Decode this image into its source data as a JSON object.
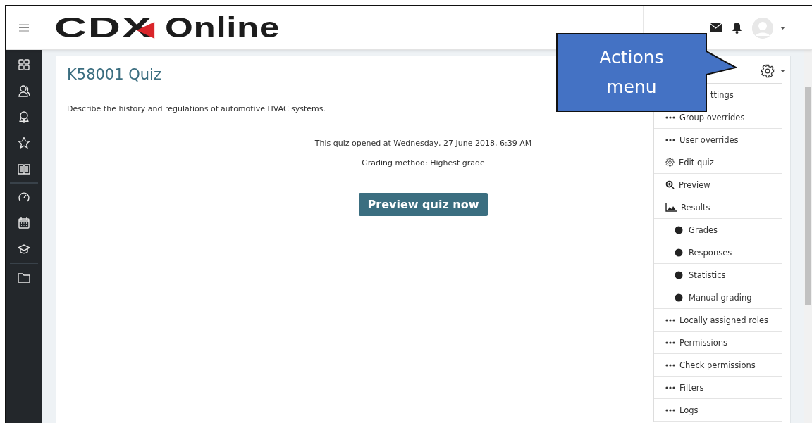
{
  "header": {
    "logo": {
      "mark": "CDX",
      "word": "Online"
    }
  },
  "sidebar": {
    "groups": [
      {
        "items": [
          {
            "kind": "grid"
          },
          {
            "kind": "people"
          },
          {
            "kind": "badge"
          },
          {
            "kind": "star"
          },
          {
            "kind": "book"
          }
        ]
      },
      {
        "items": [
          {
            "kind": "gauge"
          },
          {
            "kind": "calendar"
          },
          {
            "kind": "cap"
          }
        ]
      },
      {
        "items": [
          {
            "kind": "folder"
          }
        ]
      }
    ]
  },
  "content": {
    "title": "K58001 Quiz",
    "description": "Describe the history and regulations of automotive HVAC systems.",
    "info": [
      "This quiz opened at Wednesday, 27 June 2018, 6:39 AM",
      "Grading method: Highest grade"
    ],
    "button": "Preview quiz now"
  },
  "actions_menu": {
    "items": [
      {
        "kind": "cut",
        "label": "ttings"
      },
      {
        "kind": "dots",
        "label": "Group overrides"
      },
      {
        "kind": "dots",
        "label": "User overrides"
      },
      {
        "kind": "gear",
        "label": "Edit quiz"
      },
      {
        "kind": "zoom",
        "label": "Preview"
      },
      {
        "kind": "chart",
        "label": "Results"
      },
      {
        "kind": "bullet",
        "label": "Grades"
      },
      {
        "kind": "bullet",
        "label": "Responses"
      },
      {
        "kind": "bullet",
        "label": "Statistics"
      },
      {
        "kind": "bullet",
        "label": "Manual grading"
      },
      {
        "kind": "dots",
        "label": "Locally assigned roles"
      },
      {
        "kind": "dots",
        "label": "Permissions"
      },
      {
        "kind": "dots",
        "label": "Check permissions"
      },
      {
        "kind": "dots",
        "label": "Filters"
      },
      {
        "kind": "dots",
        "label": "Logs"
      }
    ]
  },
  "callout": {
    "lines": [
      "Actions",
      "menu"
    ]
  }
}
